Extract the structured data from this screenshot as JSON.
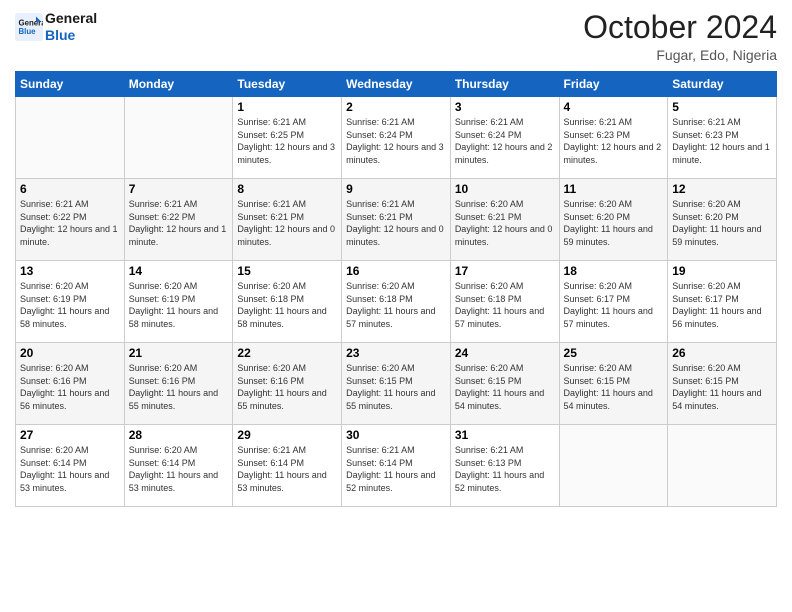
{
  "logo": {
    "line1": "General",
    "line2": "Blue"
  },
  "title": "October 2024",
  "location": "Fugar, Edo, Nigeria",
  "days_of_week": [
    "Sunday",
    "Monday",
    "Tuesday",
    "Wednesday",
    "Thursday",
    "Friday",
    "Saturday"
  ],
  "weeks": [
    [
      {
        "day": "",
        "info": ""
      },
      {
        "day": "",
        "info": ""
      },
      {
        "day": "1",
        "info": "Sunrise: 6:21 AM\nSunset: 6:25 PM\nDaylight: 12 hours and 3 minutes."
      },
      {
        "day": "2",
        "info": "Sunrise: 6:21 AM\nSunset: 6:24 PM\nDaylight: 12 hours and 3 minutes."
      },
      {
        "day": "3",
        "info": "Sunrise: 6:21 AM\nSunset: 6:24 PM\nDaylight: 12 hours and 2 minutes."
      },
      {
        "day": "4",
        "info": "Sunrise: 6:21 AM\nSunset: 6:23 PM\nDaylight: 12 hours and 2 minutes."
      },
      {
        "day": "5",
        "info": "Sunrise: 6:21 AM\nSunset: 6:23 PM\nDaylight: 12 hours and 1 minute."
      }
    ],
    [
      {
        "day": "6",
        "info": "Sunrise: 6:21 AM\nSunset: 6:22 PM\nDaylight: 12 hours and 1 minute."
      },
      {
        "day": "7",
        "info": "Sunrise: 6:21 AM\nSunset: 6:22 PM\nDaylight: 12 hours and 1 minute."
      },
      {
        "day": "8",
        "info": "Sunrise: 6:21 AM\nSunset: 6:21 PM\nDaylight: 12 hours and 0 minutes."
      },
      {
        "day": "9",
        "info": "Sunrise: 6:21 AM\nSunset: 6:21 PM\nDaylight: 12 hours and 0 minutes."
      },
      {
        "day": "10",
        "info": "Sunrise: 6:20 AM\nSunset: 6:21 PM\nDaylight: 12 hours and 0 minutes."
      },
      {
        "day": "11",
        "info": "Sunrise: 6:20 AM\nSunset: 6:20 PM\nDaylight: 11 hours and 59 minutes."
      },
      {
        "day": "12",
        "info": "Sunrise: 6:20 AM\nSunset: 6:20 PM\nDaylight: 11 hours and 59 minutes."
      }
    ],
    [
      {
        "day": "13",
        "info": "Sunrise: 6:20 AM\nSunset: 6:19 PM\nDaylight: 11 hours and 58 minutes."
      },
      {
        "day": "14",
        "info": "Sunrise: 6:20 AM\nSunset: 6:19 PM\nDaylight: 11 hours and 58 minutes."
      },
      {
        "day": "15",
        "info": "Sunrise: 6:20 AM\nSunset: 6:18 PM\nDaylight: 11 hours and 58 minutes."
      },
      {
        "day": "16",
        "info": "Sunrise: 6:20 AM\nSunset: 6:18 PM\nDaylight: 11 hours and 57 minutes."
      },
      {
        "day": "17",
        "info": "Sunrise: 6:20 AM\nSunset: 6:18 PM\nDaylight: 11 hours and 57 minutes."
      },
      {
        "day": "18",
        "info": "Sunrise: 6:20 AM\nSunset: 6:17 PM\nDaylight: 11 hours and 57 minutes."
      },
      {
        "day": "19",
        "info": "Sunrise: 6:20 AM\nSunset: 6:17 PM\nDaylight: 11 hours and 56 minutes."
      }
    ],
    [
      {
        "day": "20",
        "info": "Sunrise: 6:20 AM\nSunset: 6:16 PM\nDaylight: 11 hours and 56 minutes."
      },
      {
        "day": "21",
        "info": "Sunrise: 6:20 AM\nSunset: 6:16 PM\nDaylight: 11 hours and 55 minutes."
      },
      {
        "day": "22",
        "info": "Sunrise: 6:20 AM\nSunset: 6:16 PM\nDaylight: 11 hours and 55 minutes."
      },
      {
        "day": "23",
        "info": "Sunrise: 6:20 AM\nSunset: 6:15 PM\nDaylight: 11 hours and 55 minutes."
      },
      {
        "day": "24",
        "info": "Sunrise: 6:20 AM\nSunset: 6:15 PM\nDaylight: 11 hours and 54 minutes."
      },
      {
        "day": "25",
        "info": "Sunrise: 6:20 AM\nSunset: 6:15 PM\nDaylight: 11 hours and 54 minutes."
      },
      {
        "day": "26",
        "info": "Sunrise: 6:20 AM\nSunset: 6:15 PM\nDaylight: 11 hours and 54 minutes."
      }
    ],
    [
      {
        "day": "27",
        "info": "Sunrise: 6:20 AM\nSunset: 6:14 PM\nDaylight: 11 hours and 53 minutes."
      },
      {
        "day": "28",
        "info": "Sunrise: 6:20 AM\nSunset: 6:14 PM\nDaylight: 11 hours and 53 minutes."
      },
      {
        "day": "29",
        "info": "Sunrise: 6:21 AM\nSunset: 6:14 PM\nDaylight: 11 hours and 53 minutes."
      },
      {
        "day": "30",
        "info": "Sunrise: 6:21 AM\nSunset: 6:14 PM\nDaylight: 11 hours and 52 minutes."
      },
      {
        "day": "31",
        "info": "Sunrise: 6:21 AM\nSunset: 6:13 PM\nDaylight: 11 hours and 52 minutes."
      },
      {
        "day": "",
        "info": ""
      },
      {
        "day": "",
        "info": ""
      }
    ]
  ]
}
